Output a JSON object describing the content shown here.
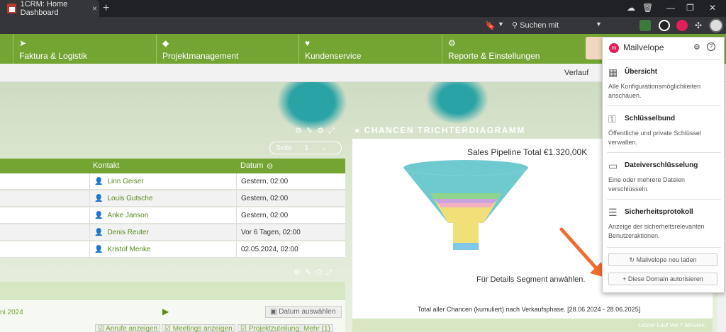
{
  "browser": {
    "tab_title": "1CRM: Home Dashboard",
    "tab_close": "×",
    "new_tab": "+",
    "search_placeholder": "Suchen mit Google",
    "minimize": "—",
    "restore": "❐",
    "close": "✕"
  },
  "nav": {
    "items": [
      {
        "label": "Faktura & Logistik",
        "icon": "paper-plane-icon"
      },
      {
        "label": "Projektmanagement",
        "icon": "cube-icon"
      },
      {
        "label": "Kundenservice",
        "icon": "heart-icon"
      },
      {
        "label": "Reporte & Einstellungen",
        "icon": "gear-icon"
      }
    ]
  },
  "subbar": {
    "history_label": "Verlauf"
  },
  "contacts": {
    "headers": {
      "contact": "Kontakt",
      "date": "Datum"
    },
    "pill_label": "Seite",
    "pill_pager": "1",
    "rows": [
      {
        "contact": "Linn Geiser",
        "date": "Gestern, 02:00"
      },
      {
        "contact": "Louis Gutsche",
        "date": "Gestern, 02:00"
      },
      {
        "contact": "Anke Janson",
        "date": "Gestern, 02:00"
      },
      {
        "contact": "Denis Reuter",
        "date": "Vor 6 Tagen, 02:00"
      },
      {
        "contact": "Kristof Menke",
        "date": "02.05.2024, 02:00"
      }
    ]
  },
  "calendar": {
    "month": "ni 2024",
    "date_button": "Datum auswählen",
    "filters": [
      "Anrufe anzeigen",
      "Meetings anzeigen",
      "Projektzuteilung",
      "Mehr (1)"
    ]
  },
  "chart": {
    "panel_title": "CHANCEN TRICHTERDIAGRAMM",
    "sales_title": "Sales Pipeline Total €1.320,00K",
    "hint": "Für Details Segment anwählen.",
    "total_note": "Total aller Chancen (kumuliert) nach Verkaufsphase. [28.06.2024 - 28.06.2025]",
    "last_run": "Letzter Lauf Vor 7 Minuten",
    "segment_colors": [
      "#6fcad0",
      "#8fd48a",
      "#c8a3dc",
      "#f0b0c0",
      "#f1e078",
      "#7ec8e8"
    ]
  },
  "mailvelope": {
    "title": "Mailvelope",
    "logo_text": "m",
    "items": [
      {
        "title": "Übersicht",
        "desc": "Alle Konfigurationsmöglichkeiten anschauen.",
        "icon": "grid-icon"
      },
      {
        "title": "Schlüsselbund",
        "desc": "Öffentliche und private Schlüssel verwalten.",
        "icon": "key-icon"
      },
      {
        "title": "Dateiverschlüsselung",
        "desc": "Eine oder mehrere Dateien verschlüsseln.",
        "icon": "file-lock-icon"
      },
      {
        "title": "Sicherheitsprotokoll",
        "desc": "Anzeige der sicherheitsrelevanten Benutzeraktionen.",
        "icon": "document-icon"
      }
    ],
    "reload_button": "Mailvelope neu laden",
    "authorize_button": "Diese Domain autorisieren"
  }
}
